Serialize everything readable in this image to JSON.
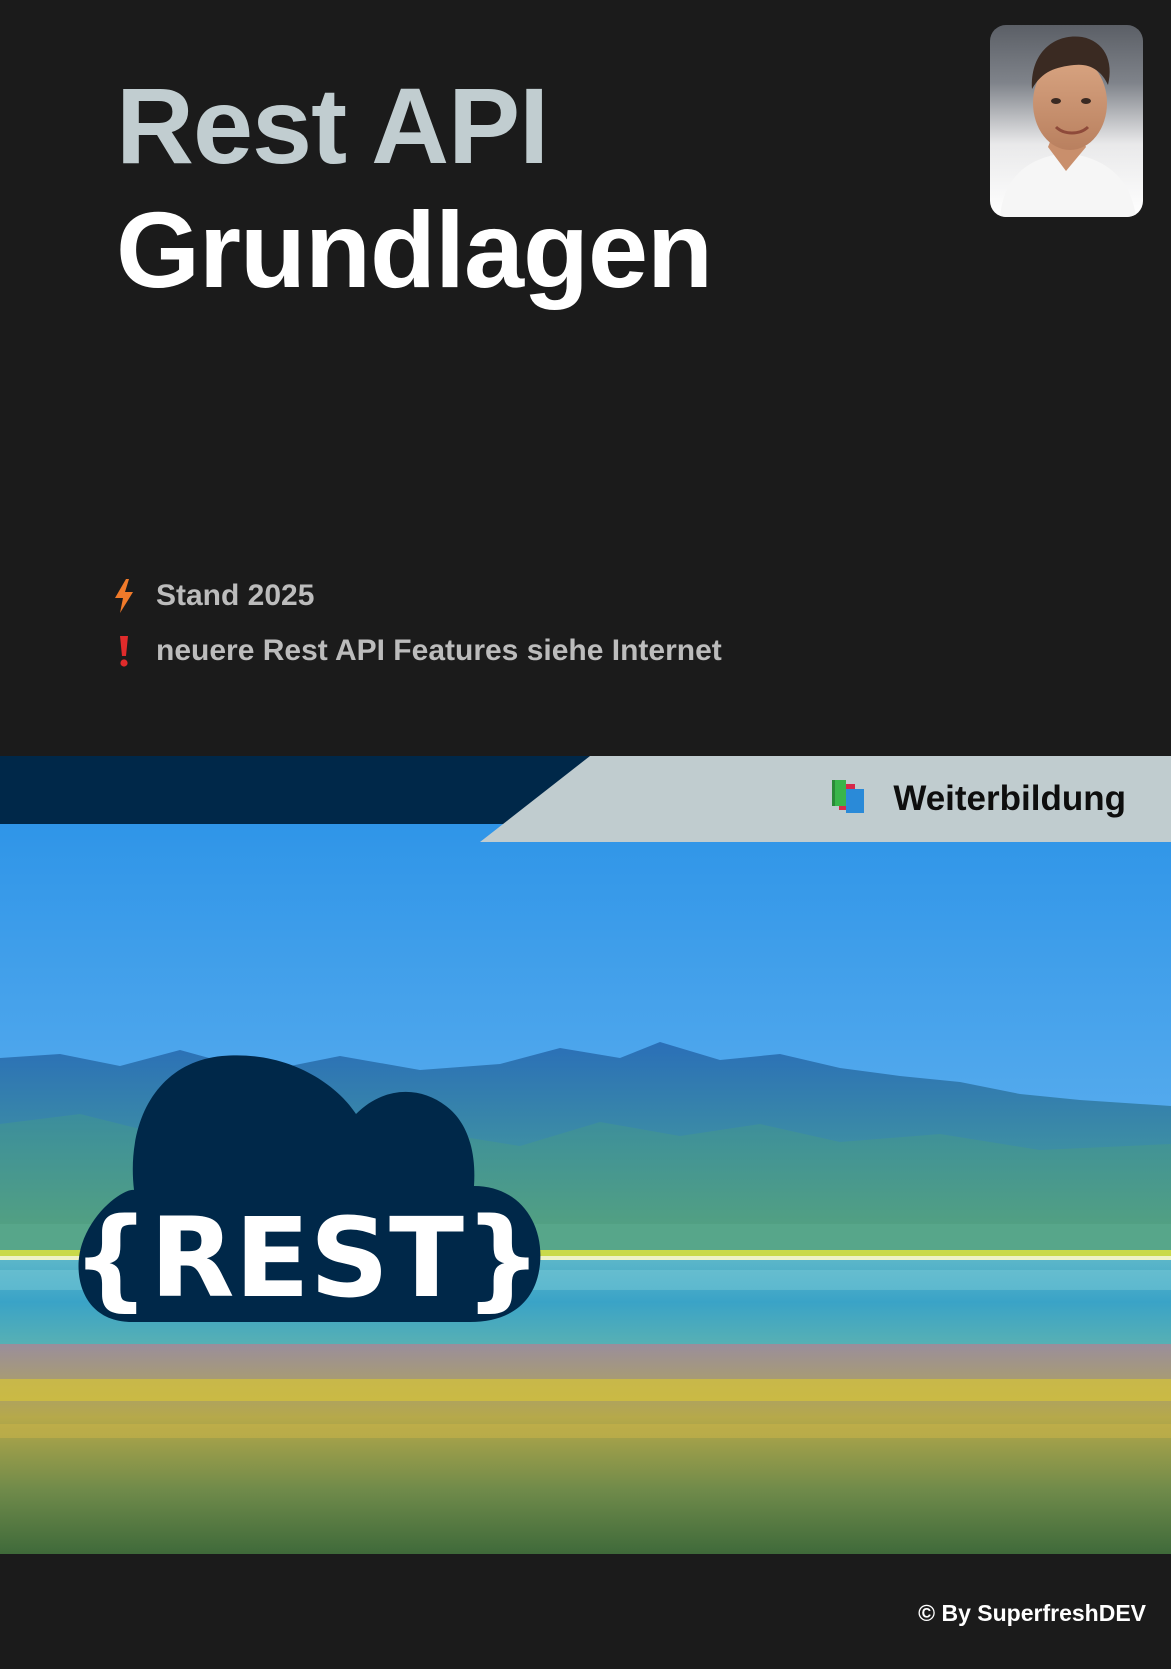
{
  "cover": {
    "title_line1": "Rest API",
    "title_line2": "Grundlagen"
  },
  "notes": [
    {
      "icon": "lightning-icon",
      "text": "Stand 2025"
    },
    {
      "icon": "exclamation-icon",
      "text": "neuere Rest API Features siehe Internet"
    }
  ],
  "banner": {
    "icon": "books-icon",
    "label": "Weiterbildung"
  },
  "logo": {
    "text": "{REST}"
  },
  "footer": {
    "credit": "© By SuperfreshDEV"
  },
  "colors": {
    "background": "#1b1b1b",
    "title_muted": "#c1cdd0",
    "title_strong": "#ffffff",
    "note_text": "#bcbcbc",
    "accent_orange": "#f07a2a",
    "accent_red": "#e02b2b",
    "banner_navy": "#002849",
    "banner_light": "#c0cccf",
    "cloud_navy": "#002849"
  }
}
